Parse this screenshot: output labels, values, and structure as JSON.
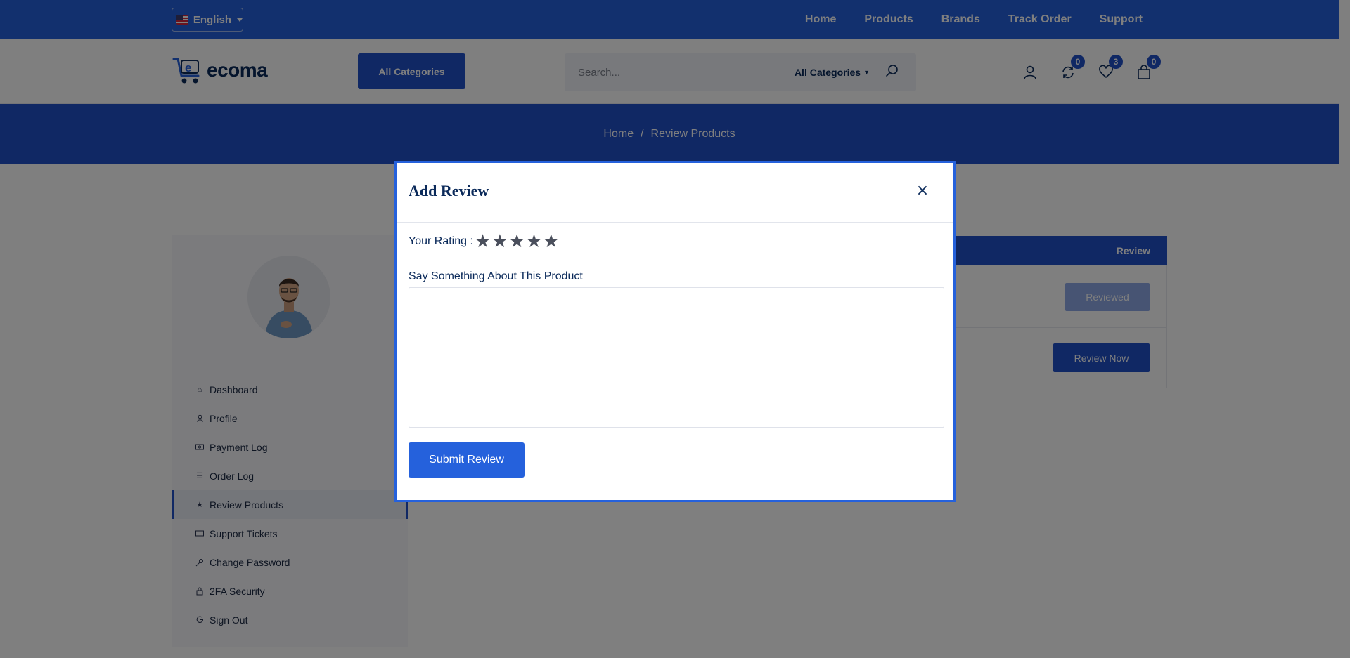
{
  "topbar": {
    "language": "English",
    "nav": [
      "Home",
      "Products",
      "Brands",
      "Track Order",
      "Support"
    ]
  },
  "header": {
    "logo_text": "ecoma",
    "categories_button": "All Categories",
    "search": {
      "placeholder": "Search...",
      "category": "All Categories"
    },
    "badges": {
      "compare": "0",
      "wishlist": "3",
      "cart": "0"
    }
  },
  "breadcrumb": {
    "home": "Home",
    "separator": "/",
    "current": "Review Products"
  },
  "sidebar": {
    "items": [
      {
        "label": "Dashboard",
        "icon": "home-icon"
      },
      {
        "label": "Profile",
        "icon": "user-icon"
      },
      {
        "label": "Payment Log",
        "icon": "money-icon"
      },
      {
        "label": "Order Log",
        "icon": "list-icon"
      },
      {
        "label": "Review Products",
        "icon": "star-icon"
      },
      {
        "label": "Support Tickets",
        "icon": "ticket-icon"
      },
      {
        "label": "Change Password",
        "icon": "key-icon"
      },
      {
        "label": "2FA Security",
        "icon": "lock-icon"
      },
      {
        "label": "Sign Out",
        "icon": "sign-out-icon"
      }
    ],
    "active_index": 4
  },
  "table": {
    "header_review": "Review",
    "reviewed_button": "Reviewed",
    "review_now_button": "Review Now"
  },
  "modal": {
    "title": "Add Review",
    "close_symbol": "×",
    "rating_label": "Your Rating :",
    "stars_total": 5,
    "review_label": "Say Something About This Product",
    "review_value": "",
    "submit": "Submit Review"
  },
  "colors": {
    "primary": "#2561dc",
    "primary_dark": "#2150c9",
    "text_dark": "#0b2a5a"
  }
}
